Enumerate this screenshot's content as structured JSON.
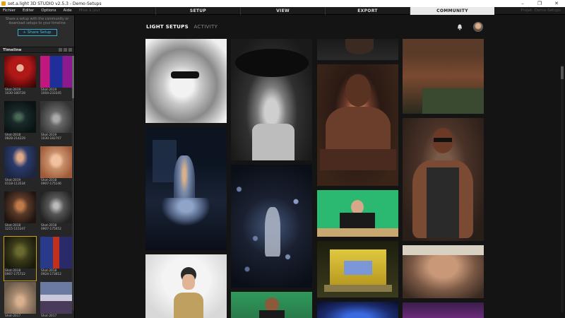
{
  "titlebar": {
    "title": "set.a.light 3D STUDIO v2.5.3 - Demo-Setups",
    "controls": [
      "–",
      "❐",
      "✕"
    ]
  },
  "menu": {
    "items": [
      "Fichier",
      "Editer",
      "Options",
      "Aide"
    ],
    "disabled_text": "Mise à jour"
  },
  "main_tabs": [
    {
      "label": "SETUP",
      "active": false
    },
    {
      "label": "VIEW",
      "active": false
    },
    {
      "label": "EXPORT",
      "active": false
    },
    {
      "label": "COMMUNITY",
      "active": true
    }
  ],
  "project_label": "Projet: Demo-Setups",
  "sidebar": {
    "share_info": "Share a setup with the community or download setups to your timeline",
    "share_button": "+ Share Setup",
    "timeline_title": "Timeline",
    "thumbs": [
      {
        "line1": "Shot-2019",
        "line2": "1030-180728"
      },
      {
        "line1": "Shot-2019",
        "line2": "1004-233345"
      },
      {
        "line1": "Shot-2018",
        "line2": "0828-214229"
      },
      {
        "line1": "Shot-2019",
        "line2": "1030-182707"
      },
      {
        "line1": "Shot-2019",
        "line2": "0118-113534"
      },
      {
        "line1": "Shot-2018",
        "line2": "0907-175146"
      },
      {
        "line1": "Shot-2018",
        "line2": "1215-115347"
      },
      {
        "line1": "Shot-2018",
        "line2": "0907-175052"
      },
      {
        "line1": "Shot-2018",
        "line2": "0907-175722",
        "selected": true
      },
      {
        "line1": "Shot-2018",
        "line2": "0924-173612"
      },
      {
        "line1": "Shot-2017",
        "line2": ""
      },
      {
        "line1": "Shot-2017",
        "line2": ""
      }
    ]
  },
  "content": {
    "nav_active": "LIGHT SETUPS",
    "nav_inactive": "ACTIVITY"
  },
  "icons": {
    "bell": "bell-icon",
    "avatar": "user-avatar"
  },
  "colors": {
    "accent": "#3fa7c8",
    "selected_outline": "#c9a21a",
    "active_tab_bg": "#e9e9e9"
  }
}
